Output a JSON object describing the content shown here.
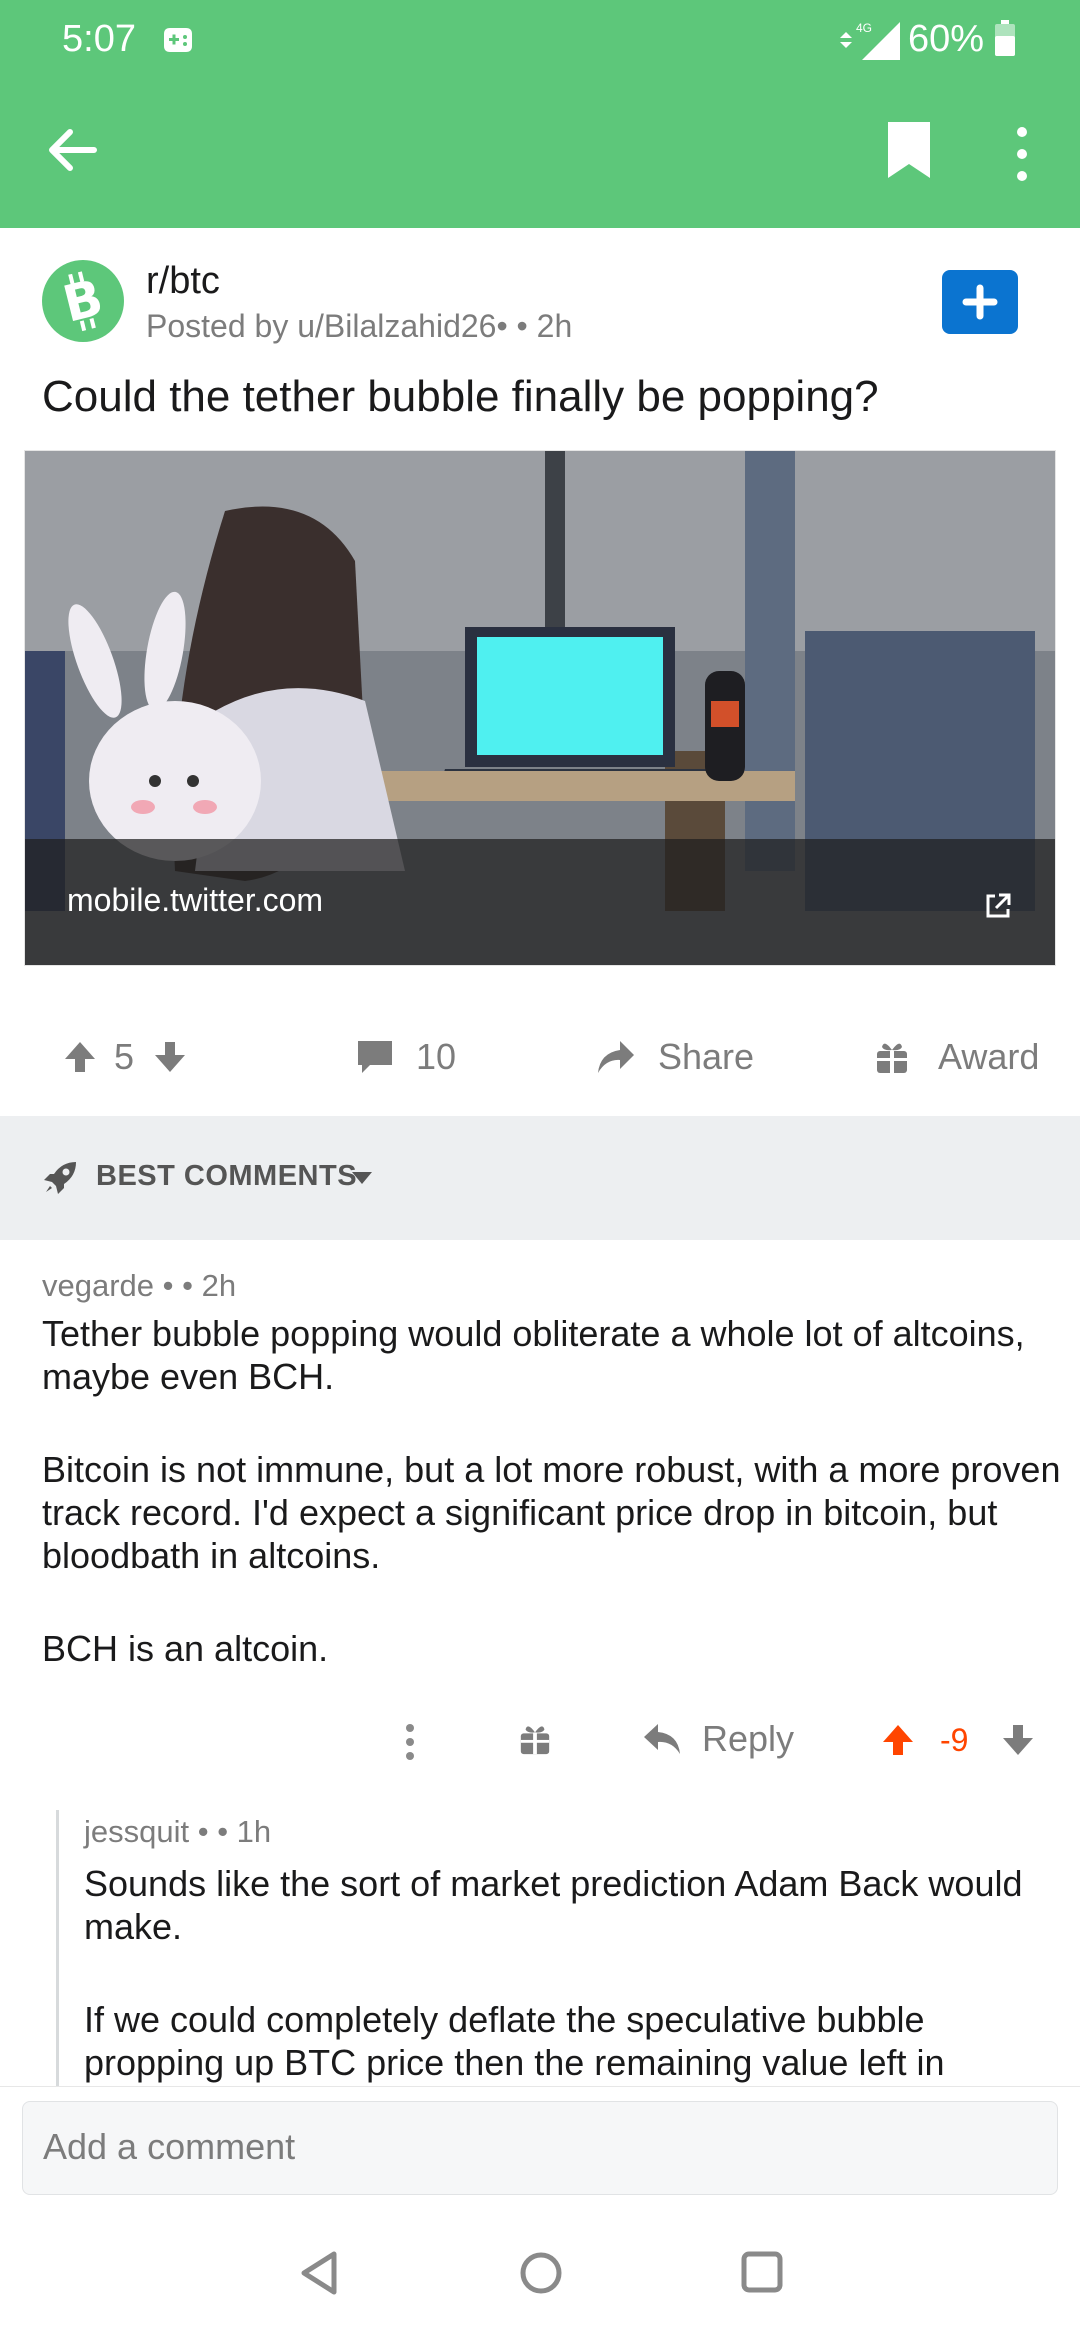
{
  "status": {
    "time": "5:07",
    "network": "4G",
    "battery": "60%"
  },
  "post": {
    "subreddit": "r/btc",
    "posted_by": "Posted by u/Bilalzahid26•",
    "age": "• 2h",
    "title": "Could the tether bubble finally be popping?",
    "link_domain": "mobile.twitter.com",
    "upvotes": "5",
    "comments": "10",
    "share_label": "Share",
    "award_label": "Award"
  },
  "sort": {
    "label": "BEST COMMENTS"
  },
  "comments": [
    {
      "author": "vegarde •",
      "age": "• 2h",
      "paragraphs": [
        "Tether bubble popping would obliterate a whole lot of altcoins, maybe even BCH.",
        "Bitcoin is not immune, but a lot more robust, with a more proven track record. I'd expect a significant price drop in bitcoin, but bloodbath in altcoins.",
        "BCH is an altcoin."
      ],
      "reply_label": "Reply",
      "score": "-9"
    },
    {
      "author": "jessquit •",
      "age": "• 1h",
      "paragraphs": [
        "Sounds like the sort of market prediction Adam Back would make.",
        "If we could completely deflate the speculative bubble propping up BTC price then the remaining value left in"
      ]
    }
  ],
  "compose": {
    "placeholder": "Add a comment"
  },
  "colors": {
    "app_bar": "#5dc77a",
    "join": "#0b74d0",
    "downvoted": "#ff4500"
  }
}
